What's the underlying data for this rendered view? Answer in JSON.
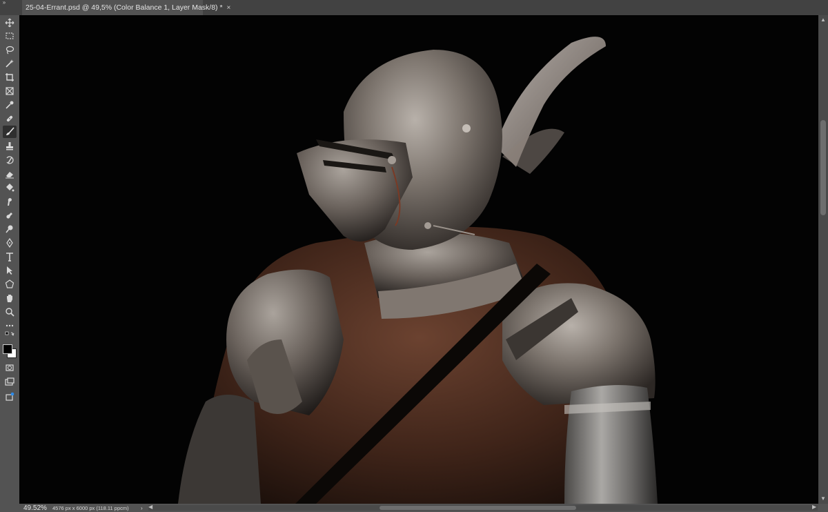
{
  "document": {
    "tab_title": "25-04-Errant.psd @ 49,5% (Color Balance 1, Layer Mask/8) *",
    "close_glyph": "×",
    "collapse_glyph": "»"
  },
  "toolbar": {
    "tools": [
      "move-tool-icon",
      "marquee-tool-icon",
      "lasso-tool-icon",
      "magic-wand-tool-icon",
      "crop-tool-icon",
      "frame-tool-icon",
      "eyedropper-tool-icon",
      "healing-brush-tool-icon",
      "brush-tool-icon",
      "clone-stamp-tool-icon",
      "history-brush-tool-icon",
      "eraser-tool-icon",
      "paint-bucket-tool-icon",
      "smudge-tool-icon",
      "burn-tool-icon",
      "dodge-tool-icon",
      "pen-tool-icon",
      "type-tool-icon",
      "path-selection-tool-icon",
      "shape-tool-icon",
      "hand-tool-icon",
      "zoom-tool-icon",
      "more-tools-icon"
    ],
    "active_tool": "brush-tool-icon",
    "foreground_color": "#000000",
    "background_color": "#ffffff"
  },
  "status": {
    "zoom": "49.52%",
    "doc_size": "4576 px x 6000 px (118.11 ppcm)",
    "arrow": "›"
  },
  "scroll": {
    "up": "▲",
    "down": "▼",
    "left": "◀",
    "right": "▶"
  }
}
